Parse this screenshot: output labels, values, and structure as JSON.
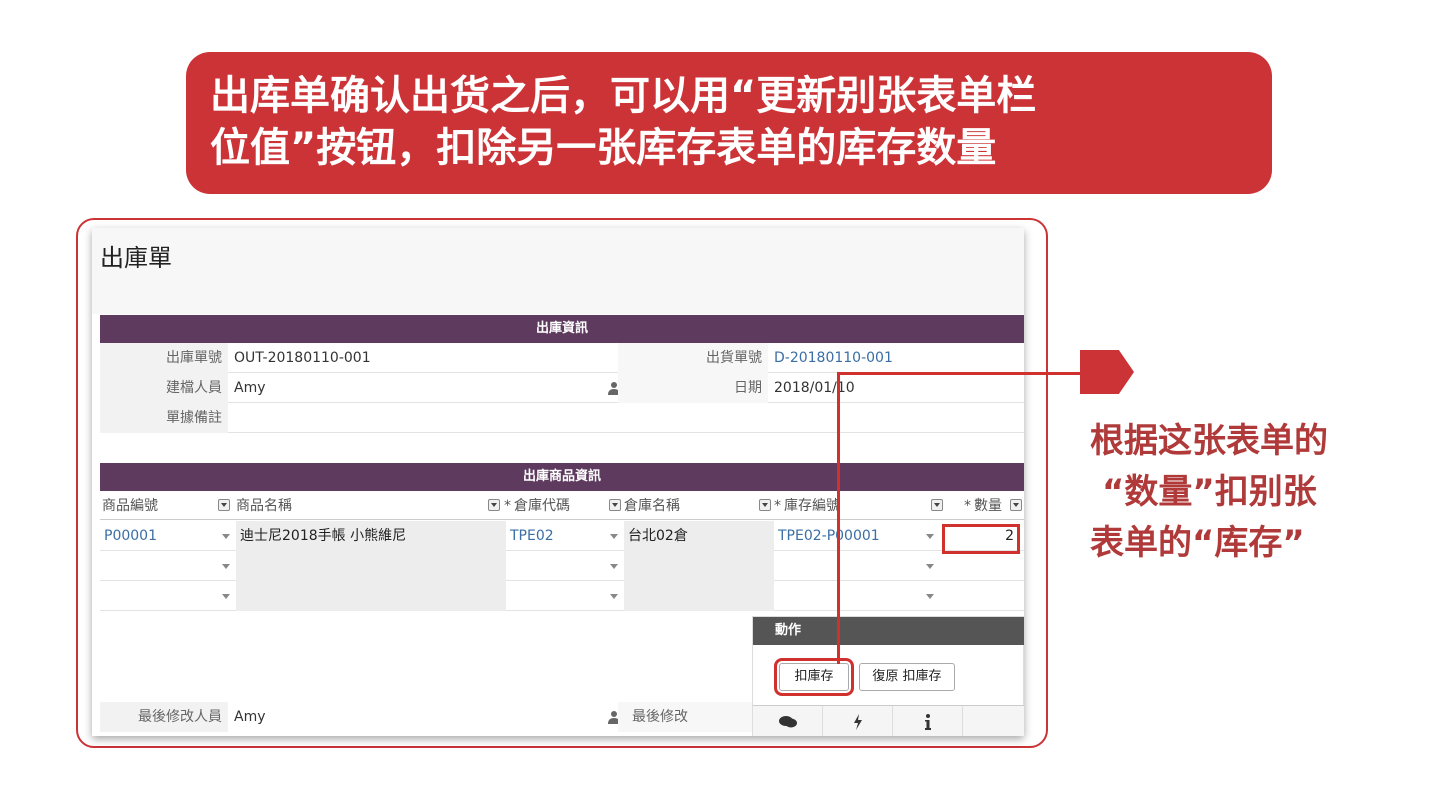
{
  "banner": {
    "line1": "出库单确认出货之后，可以用“更新别张表单栏",
    "line2": "位值”按钮，扣除另一张库存表单的库存数量"
  },
  "form": {
    "title": "出庫單",
    "section1": "出庫資訊",
    "fields": {
      "out_no_label": "出庫單號",
      "out_no": "OUT-20180110-001",
      "ship_no_label": "出貨單號",
      "ship_no": "D-20180110-001",
      "creator_label": "建檔人員",
      "creator": "Amy",
      "date_label": "日期",
      "date": "2018/01/10",
      "note_label": "單據備註"
    },
    "section2": "出庫商品資訊",
    "grid": {
      "headers": {
        "product_code": "商品編號",
        "product_name": "商品名稱",
        "warehouse_code": "倉庫代碼",
        "warehouse_name": "倉庫名稱",
        "stock_no": "庫存編號",
        "qty": "數量"
      },
      "required_mark": "*",
      "rows": [
        {
          "product_code": "P00001",
          "product_name": "迪士尼2018手帳 小熊維尼",
          "warehouse_code": "TPE02",
          "warehouse_name": "台北02倉",
          "stock_no": "TPE02-P00001",
          "qty": "2"
        }
      ]
    },
    "footer": {
      "modifier_label": "最後修改人員",
      "modifier": "Amy",
      "modified_label": "最後修改"
    },
    "actions": {
      "title": "動作",
      "deduct_button": "扣庫存",
      "restore_button": "復原 扣庫存"
    }
  },
  "side_note": {
    "line1": "根据这张表单的",
    "line2": "“数量”扣别张",
    "line3": "表单的“库存”"
  }
}
